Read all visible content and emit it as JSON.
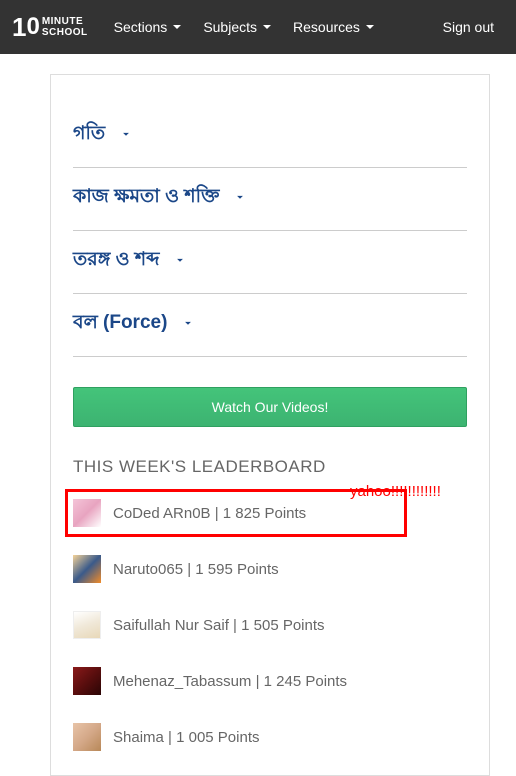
{
  "header": {
    "logo": {
      "num": "10",
      "line1": "MINUTE",
      "line2": "SCHOOL"
    },
    "nav": [
      {
        "label": "Sections"
      },
      {
        "label": "Subjects"
      },
      {
        "label": "Resources"
      }
    ],
    "signout": "Sign out"
  },
  "topics": [
    {
      "title": "গতি"
    },
    {
      "title": "কাজ ক্ষমতা ও শক্তি"
    },
    {
      "title": "তরঙ্গ ও শব্দ"
    },
    {
      "title": "বল (Force)"
    }
  ],
  "watch_button": "Watch Our Videos!",
  "leaderboard": {
    "title": "THIS WEEK'S LEADERBOARD",
    "rows": [
      {
        "text": "CoDed ARn0B | 1 825 Points",
        "avatar": "pink",
        "highlight": true
      },
      {
        "text": "Naruto065 | 1 595 Points",
        "avatar": "naruto"
      },
      {
        "text": "Saifullah Nur Saif | 1 505 Points",
        "avatar": "paper"
      },
      {
        "text": "Mehenaz_Tabassum | 1 245 Points",
        "avatar": "roses"
      },
      {
        "text": "Shaima | 1 005 Points",
        "avatar": "girl"
      }
    ]
  },
  "annotation": "yahoo!!!!!!!!!!!!"
}
